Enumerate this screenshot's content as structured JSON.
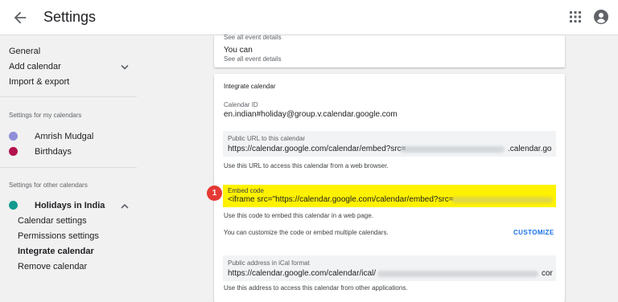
{
  "header": {
    "title": "Settings"
  },
  "sidebar": {
    "general": "General",
    "add_calendar": "Add calendar",
    "import_export": "Import & export",
    "my_calendars_heading": "Settings for my calendars",
    "my_calendars": [
      {
        "name": "Amrish Mudgal",
        "color": "#8e8fd8"
      },
      {
        "name": "Birthdays",
        "color": "#b3124f"
      }
    ],
    "other_calendars_heading": "Settings for other calendars",
    "other_calendar": {
      "name": "Holidays in India",
      "color": "#129a8f"
    },
    "sub_items": [
      "Calendar settings",
      "Permissions settings",
      "Integrate calendar",
      "Remove calendar"
    ]
  },
  "card1": {
    "see_details_top": "See all event details",
    "you_can": "You can",
    "see_details": "See all event details"
  },
  "integrate": {
    "title": "Integrate calendar",
    "calendar_id_label": "Calendar ID",
    "calendar_id": "en.indian#holiday@group.v.calendar.google.com",
    "public_url_label": "Public URL to this calendar",
    "public_url_prefix": "https://calendar.google.com/calendar/embed?src=",
    "public_url_suffix": ".calendar.go",
    "public_url_help": "Use this URL to access this calendar from a web browser.",
    "embed_label": "Embed code",
    "embed_code": "<iframe src=\"https://calendar.google.com/calendar/embed?src=",
    "embed_help": "Use this code to embed this calendar in a web page.",
    "customize_help": "You can customize the code or embed multiple calendars.",
    "customize_button": "CUSTOMIZE",
    "ical_label": "Public address in iCal format",
    "ical_prefix": "https://calendar.google.com/calendar/ical/",
    "ical_suffix": "cor",
    "ical_help": "Use this address to access this calendar from other applications."
  },
  "badge": "1"
}
